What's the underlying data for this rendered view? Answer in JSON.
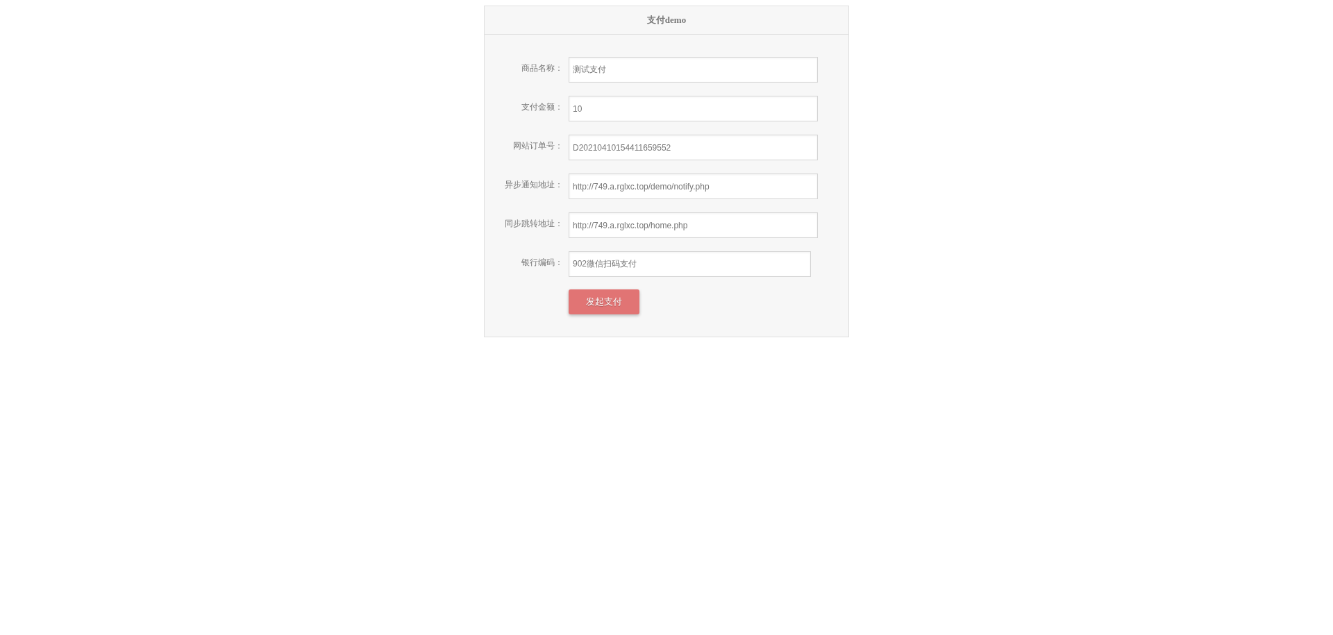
{
  "panel": {
    "title": "支付demo"
  },
  "fields": [
    {
      "label": "商品名称：",
      "value": "测试支付",
      "kind": "text"
    },
    {
      "label": "支付金额：",
      "value": "10",
      "kind": "text"
    },
    {
      "label": "网站订单号：",
      "value": "D20210410154411659552",
      "kind": "text"
    },
    {
      "label": "异步通知地址：",
      "value": "http://749.a.rglxc.top/demo/notify.php",
      "kind": "text"
    },
    {
      "label": "同步跳转地址：",
      "value": "http://749.a.rglxc.top/home.php",
      "kind": "text"
    },
    {
      "label": "银行编码：",
      "value": "902微信扫码支付",
      "kind": "select"
    }
  ],
  "submit": {
    "label": "发起支付"
  }
}
